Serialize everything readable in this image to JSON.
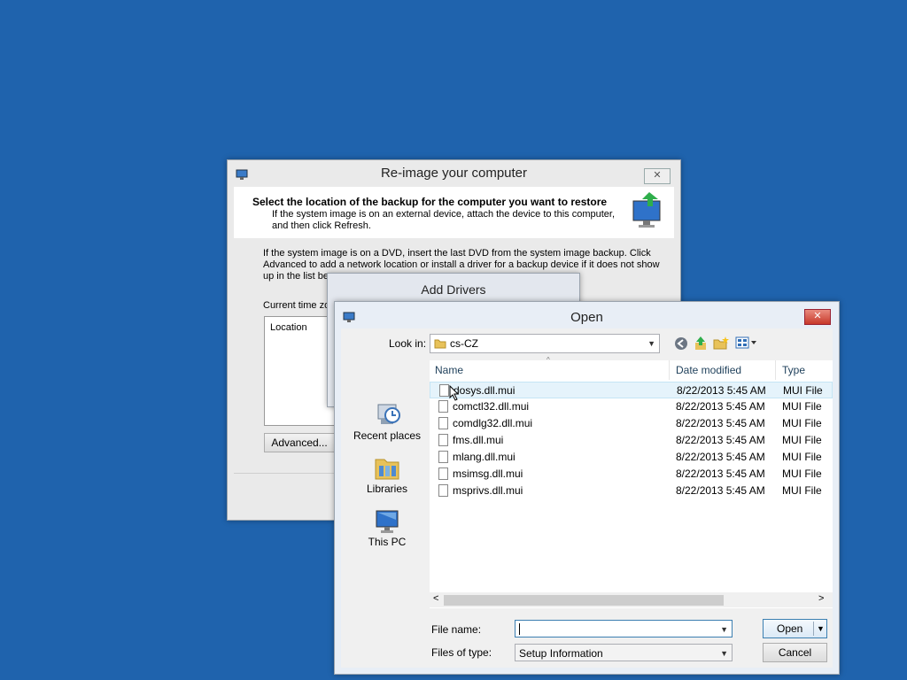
{
  "reimage": {
    "title": "Re-image your computer",
    "close": "✕",
    "heading": "Select the location of the backup for the computer you want to restore",
    "subtext_line1": "If the system image is on an external device, attach the device to this computer,",
    "subtext_line2": "and then click Refresh.",
    "body_line1": "If the system image is on a DVD, insert the last DVD from the system image backup. Click",
    "body_line2": "Advanced to add a network location or install a driver for a backup device if it does not show",
    "body_line3": "up in the list be",
    "timezone_label": "Current time zo",
    "location_header": "Location",
    "advanced_button": "Advanced..."
  },
  "add_drivers": {
    "title": "Add Drivers"
  },
  "open_dialog": {
    "title": "Open",
    "close": "✕",
    "look_in_label": "Look in:",
    "look_in_value": "cs-CZ",
    "places": [
      {
        "label": "Recent places",
        "icon": "recent-places-icon"
      },
      {
        "label": "Libraries",
        "icon": "libraries-icon"
      },
      {
        "label": "This PC",
        "icon": "this-pc-icon"
      }
    ],
    "columns": {
      "name": "Name",
      "date": "Date modified",
      "type": "Type"
    },
    "files": [
      {
        "name": "dosys.dll.mui",
        "date": "8/22/2013 5:45 AM",
        "type": "MUI File"
      },
      {
        "name": "comctl32.dll.mui",
        "date": "8/22/2013 5:45 AM",
        "type": "MUI File"
      },
      {
        "name": "comdlg32.dll.mui",
        "date": "8/22/2013 5:45 AM",
        "type": "MUI File"
      },
      {
        "name": "fms.dll.mui",
        "date": "8/22/2013 5:45 AM",
        "type": "MUI File"
      },
      {
        "name": "mlang.dll.mui",
        "date": "8/22/2013 5:45 AM",
        "type": "MUI File"
      },
      {
        "name": "msimsg.dll.mui",
        "date": "8/22/2013 5:45 AM",
        "type": "MUI File"
      },
      {
        "name": "msprivs.dll.mui",
        "date": "8/22/2013 5:45 AM",
        "type": "MUI File"
      }
    ],
    "file_name_label": "File name:",
    "file_name_value": "",
    "files_of_type_label": "Files of type:",
    "files_of_type_value": "Setup Information",
    "open_button": "Open",
    "cancel_button": "Cancel"
  }
}
